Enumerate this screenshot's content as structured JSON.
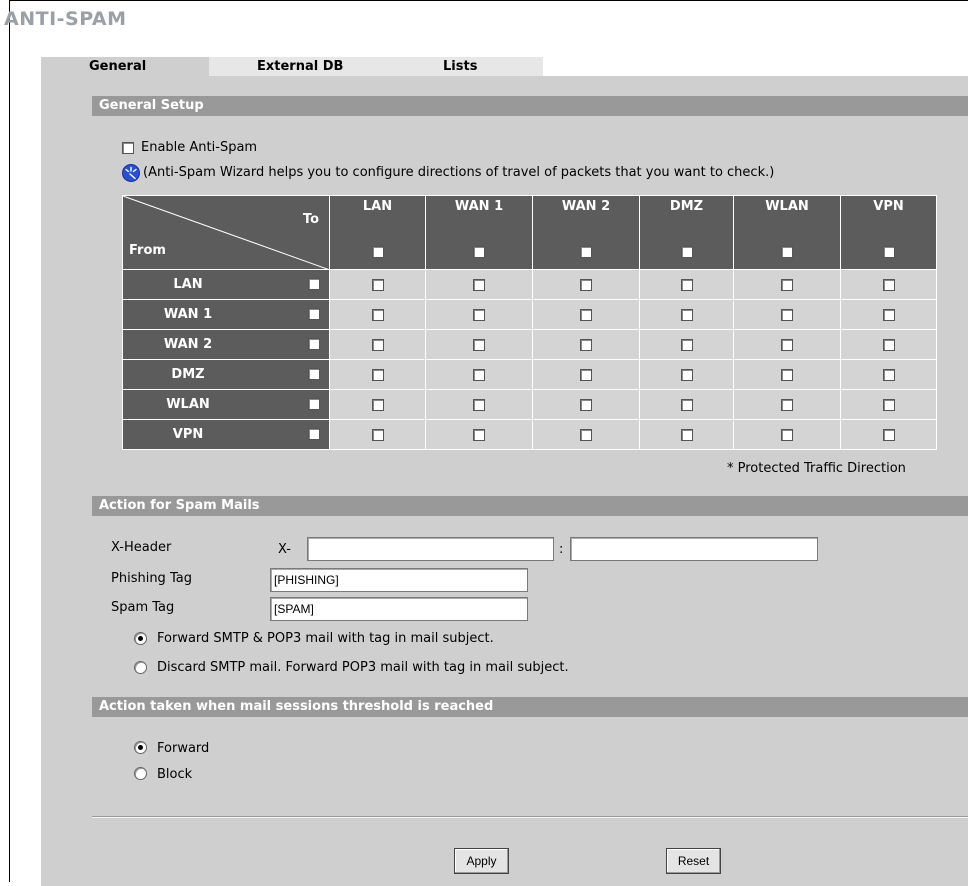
{
  "page": {
    "title": "ANTI-SPAM"
  },
  "tabs": [
    {
      "label": "General",
      "active": true
    },
    {
      "label": "External DB",
      "active": false
    },
    {
      "label": "Lists",
      "active": false
    }
  ],
  "general_setup": {
    "heading": "General Setup",
    "enable_label": "Enable Anti-Spam",
    "enable_checked": false,
    "wizard_icon": "wizard-icon",
    "wizard_text": "(Anti-Spam Wizard helps you to configure directions of travel of packets that you want to check.)",
    "matrix": {
      "to_label": "To",
      "from_label": "From",
      "columns": [
        "LAN",
        "WAN 1",
        "WAN 2",
        "DMZ",
        "WLAN",
        "VPN"
      ],
      "rows": [
        "LAN",
        "WAN 1",
        "WAN 2",
        "DMZ",
        "WLAN",
        "VPN"
      ]
    },
    "footnote": "* Protected Traffic Direction"
  },
  "action_spam": {
    "heading": "Action for Spam Mails",
    "xheader_label": "X-Header",
    "xheader_prefix": "X-",
    "xheader_sep": ":",
    "xheader_name": "",
    "xheader_value": "",
    "phishing_label": "Phishing Tag",
    "phishing_value": "[PHISHING]",
    "spam_label": "Spam Tag",
    "spam_value": "[SPAM]",
    "options": [
      {
        "label": "Forward SMTP & POP3 mail with tag in mail subject.",
        "selected": true
      },
      {
        "label": "Discard SMTP mail. Forward POP3 mail with tag in mail subject.",
        "selected": false
      }
    ]
  },
  "threshold": {
    "heading": "Action taken when mail sessions threshold is reached",
    "options": [
      {
        "label": "Forward",
        "selected": true
      },
      {
        "label": "Block",
        "selected": false
      }
    ]
  },
  "buttons": {
    "apply": "Apply",
    "reset": "Reset"
  },
  "colors": {
    "panel": "#cfcfcf",
    "section_bar": "#999999",
    "matrix_header": "#5c5c5c",
    "title": "#9aa0a6"
  }
}
